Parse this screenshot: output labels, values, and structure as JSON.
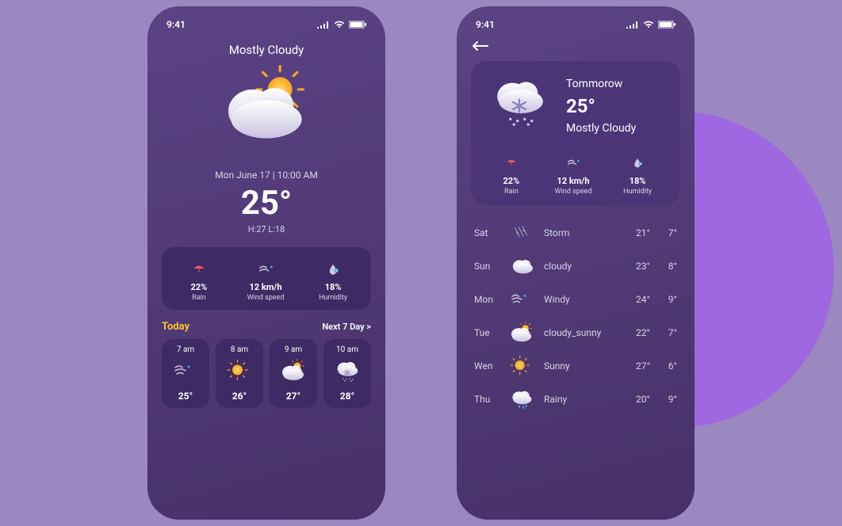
{
  "status": {
    "time": "9:41"
  },
  "screen1": {
    "condition": "Mostly Cloudy",
    "datetime": "Mon June 17 | 10:00 AM",
    "temp": "25°",
    "hilow": "H:27  L:18",
    "stats": {
      "rain": {
        "value": "22%",
        "label": "Rain"
      },
      "wind": {
        "value": "12 km/h",
        "label": "Wind speed"
      },
      "humidity": {
        "value": "18%",
        "label": "Humidity"
      }
    },
    "today_label": "Today",
    "next7_label": "Next 7 Day >",
    "hours": [
      {
        "time": "7 am",
        "icon": "windy",
        "temp": "25°"
      },
      {
        "time": "8 am",
        "icon": "sunny",
        "temp": "26°"
      },
      {
        "time": "9 am",
        "icon": "cloudy_sunny",
        "temp": "27°"
      },
      {
        "time": "10 am",
        "icon": "snow",
        "temp": "28°"
      }
    ]
  },
  "screen2": {
    "summary": {
      "day": "Tommorow",
      "temp": "25°",
      "condition": "Mostly Cloudy",
      "stats": {
        "rain": {
          "value": "22%",
          "label": "Rain"
        },
        "wind": {
          "value": "12 km/h",
          "label": "Wind speed"
        },
        "humidity": {
          "value": "18%",
          "label": "Humidity"
        }
      }
    },
    "days": [
      {
        "name": "Sat",
        "icon": "storm",
        "cond": "Storm",
        "hi": "21°",
        "lo": "7°"
      },
      {
        "name": "Sun",
        "icon": "cloudy",
        "cond": "cloudy",
        "hi": "23°",
        "lo": "8°"
      },
      {
        "name": "Mon",
        "icon": "windy",
        "cond": "Windy",
        "hi": "24°",
        "lo": "9°"
      },
      {
        "name": "Tue",
        "icon": "cloudy_sunny",
        "cond": "cloudy_sunny",
        "hi": "22°",
        "lo": "7°"
      },
      {
        "name": "Wen",
        "icon": "sunny",
        "cond": "Sunny",
        "hi": "27°",
        "lo": "6°"
      },
      {
        "name": "Thu",
        "icon": "rainy",
        "cond": "Rainy",
        "hi": "20°",
        "lo": "9°"
      }
    ]
  }
}
